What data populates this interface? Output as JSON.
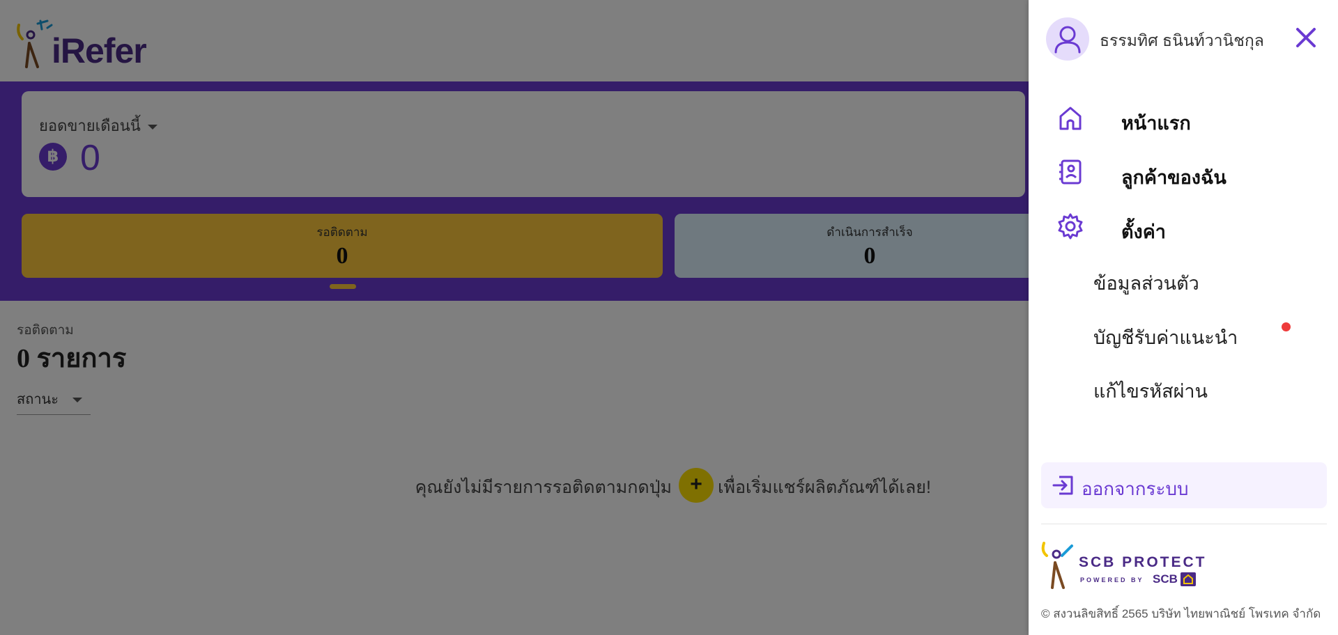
{
  "header": {
    "logo_text": "iRefer"
  },
  "sales": {
    "label": "ยอดขายเดือนนี้",
    "currency_symbol": "฿",
    "value": "0"
  },
  "status_cards": [
    {
      "label": "รอติดตาม",
      "count": "0"
    },
    {
      "label": "ดำเนินการสำเร็จ",
      "count": "0"
    }
  ],
  "section": {
    "subtitle": "รอติดตาม",
    "count_text": "0 รายการ"
  },
  "filter": {
    "label": "สถานะ"
  },
  "empty_state": {
    "before_button": "คุณยังไม่มีรายการรอติดตามกดปุ่ม",
    "button_symbol": "+",
    "after_button": "เพื่อเริ่มแชร์ผลิตภัณฑ์ได้เลย!"
  },
  "drawer": {
    "user_name": "ธรรมทิศ ธนินท์วานิชกุล",
    "menu": [
      {
        "label": "หน้าแรก",
        "icon": "home-icon"
      },
      {
        "label": "ลูกค้าของฉัน",
        "icon": "contacts-icon"
      },
      {
        "label": "ตั้งค่า",
        "icon": "gear-icon"
      }
    ],
    "settings_sub": [
      "ข้อมูลส่วนตัว",
      "บัญชีรับค่าแนะนำ",
      "แก้ไขรหัสผ่าน"
    ],
    "logout_label": "ออกจากระบบ",
    "brand": {
      "name": "SCB PROTECT",
      "tagline": "POWERED BY",
      "bank": "SCB"
    },
    "copyright": "© สงวนลิขสิทธิ์ 2565 บริษัท ไทยพาณิชย์ โพรเทค จำกัด"
  },
  "colors": {
    "primary": "#6a3ad2",
    "pending_card": "#ffc93c",
    "progress_card": "#def3ff",
    "plus_button": "#ffe003",
    "notification_dot": "#ee3b3b"
  }
}
